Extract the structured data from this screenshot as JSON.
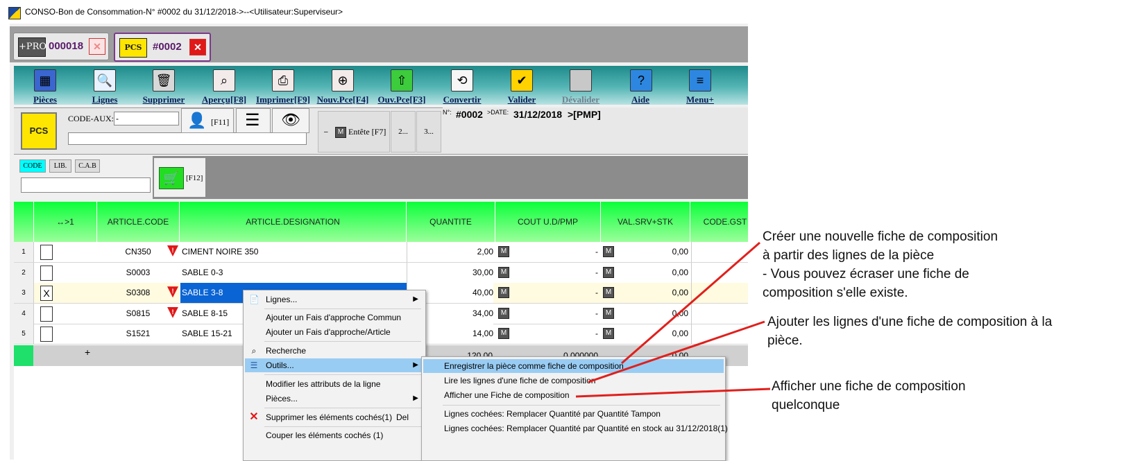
{
  "window": {
    "title": "CONSO-Bon de Consommation-N° #0002 du 31/12/2018->--<Utilisateur:Superviseur>"
  },
  "doc_tabs": [
    {
      "icon": "+PRO",
      "label": "000018",
      "close": "✕"
    },
    {
      "icon": "PCS",
      "label": "#0002",
      "close": "✕"
    }
  ],
  "toolbar": {
    "items": [
      {
        "label": "Pièces",
        "icon": "grid-icon",
        "glyph": "▦",
        "color": "#3a66d0"
      },
      {
        "label": "Lignes",
        "icon": "magnifier-icon",
        "glyph": "🔍",
        "color": "#e9f2ff"
      },
      {
        "label": "Supprimer",
        "icon": "trash-icon",
        "glyph": "🗑",
        "color": "#d8d8d8"
      },
      {
        "label": "Aperçu[F8]",
        "icon": "preview-icon",
        "glyph": "⌕",
        "color": "#f3eaea"
      },
      {
        "label": "Imprimer[F9]",
        "icon": "printer-icon",
        "glyph": "⎙",
        "color": "#f3eaea"
      },
      {
        "label": "Nouv.Pce[F4]",
        "icon": "new-piece-icon",
        "glyph": "⊕",
        "color": "#f3eaea"
      },
      {
        "label": "Ouv.Pce[F3]",
        "icon": "open-piece-icon",
        "glyph": "⇧",
        "color": "#3ccc3c"
      },
      {
        "label": "Convertir",
        "icon": "convert-icon",
        "glyph": "⟲",
        "color": "#f6f6f6"
      },
      {
        "label": "Valider",
        "icon": "validate-icon",
        "glyph": "✔",
        "color": "#ffd200"
      },
      {
        "label": "Dévalider",
        "icon": "unvalidate-icon",
        "glyph": "",
        "color": "#c8c8c8"
      },
      {
        "label": "Aide",
        "icon": "help-icon",
        "glyph": "?",
        "color": "#2d87e0"
      },
      {
        "label": "Menu+",
        "icon": "menu-lines-icon",
        "glyph": "≡",
        "color": "#2d87e0"
      }
    ]
  },
  "header": {
    "logo": "PCS",
    "code_aux_label": "CODE-AUX:",
    "code_aux_value": "-",
    "f11": "[F11]",
    "entete": "Entête [F7]",
    "entete_m": "M",
    "tab2": "2...",
    "tab3": "3...",
    "no_label": "N°:",
    "no_value": "#0002",
    "date_label": ">DATE:",
    "date_value": "31/12/2018",
    "pmp": ">[PMP]"
  },
  "search": {
    "tabs": [
      "CODE",
      "LIB.",
      "C.A.B"
    ],
    "f12": "[F12]"
  },
  "grid": {
    "columns": [
      "↔>1",
      "ARTICLE.CODE",
      "ARTICLE.DESIGNATION",
      "QUANTITE",
      "COUT U.D/PMP",
      "VAL.SRV+STK",
      "CODE.GST"
    ],
    "rows": [
      {
        "n": "1",
        "check": "",
        "code": "CN350",
        "warn": true,
        "designation": "CIMENT NOIRE 350",
        "qty": "2,00",
        "cout": "-",
        "val": "0,00"
      },
      {
        "n": "2",
        "check": "",
        "code": "S0003",
        "warn": false,
        "designation": "SABLE 0-3",
        "qty": "30,00",
        "cout": "-",
        "val": "0,00"
      },
      {
        "n": "3",
        "check": "X",
        "code": "S0308",
        "warn": true,
        "designation": "SABLE 3-8",
        "qty": "40,00",
        "cout": "-",
        "val": "0,00"
      },
      {
        "n": "4",
        "check": "",
        "code": "S0815",
        "warn": true,
        "designation": "SABLE 8-15",
        "qty": "34,00",
        "cout": "-",
        "val": "0,00"
      },
      {
        "n": "5",
        "check": "",
        "code": "S1521",
        "warn": false,
        "designation": "SABLE 15-21",
        "qty": "14,00",
        "cout": "-",
        "val": "0,00"
      }
    ],
    "m": "M",
    "totals": {
      "plus": "+",
      "qty": "120,00",
      "cout": "0,000000",
      "val": "0,00"
    }
  },
  "context_menu": {
    "lignes": "Lignes...",
    "fais_commun": "Ajouter un Fais d'approche Commun",
    "fais_article": "Ajouter un Fais d'approche/Article",
    "recherche": "Recherche",
    "outils": "Outils...",
    "modifier": "Modifier les attributs de la ligne",
    "pieces": "Pièces...",
    "supprimer": "Supprimer les éléments cochés(1)",
    "supprimer_shortcut": "Del",
    "couper": "Couper les éléments cochés (1)"
  },
  "submenu": {
    "enregistrer": "Enregistrer la pièce comme fiche de composition",
    "lire": "Lire les lignes d'une fiche de composition",
    "afficher": "Afficher une Fiche de composition",
    "tampon": "Lignes cochées: Remplacer Quantité par Quantité Tampon",
    "stock": "Lignes cochées: Remplacer Quantité par Quantité en stock au 31/12/2018(1)"
  },
  "annotations": {
    "note1": [
      "Créer une nouvelle fiche de composition",
      "à partir des lignes de la pièce",
      "- Vous pouvez écraser une fiche de",
      "composition s'elle existe."
    ],
    "note2": [
      "Ajouter les lignes d'une fiche de composition à la",
      "pièce."
    ],
    "note3": [
      "Afficher une fiche de composition",
      "quelconque"
    ],
    "arrow_color": "#e0201c"
  }
}
